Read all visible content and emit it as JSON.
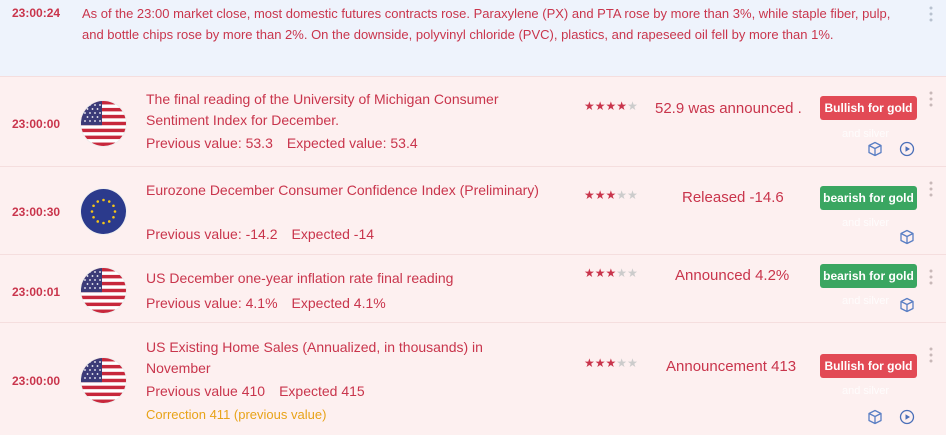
{
  "news": {
    "time": "23:00:24",
    "text": "As of the 23:00 market close, most domestic futures contracts rose. Paraxylene (PX) and PTA rose by more than 3%, while staple fiber, pulp, and bottle chips rose by more than 2%. On the downside, polyvinyl chloride (PVC), plastics, and rapeseed oil fell by more than 1%."
  },
  "events": [
    {
      "time": "23:00:00",
      "flag": "us-flag-icon",
      "title": "The final reading of the University of Michigan Consumer Sentiment Index for December.",
      "previous": "Previous value: 53.3",
      "expected": "Expected value: 53.4",
      "stars": 4,
      "actual": "52.9 was announced .",
      "badge": "Bullish for gold",
      "badge_type": "bull",
      "badge_sub": "and silver"
    },
    {
      "time": "23:00:30",
      "flag": "eu-flag-icon",
      "title": "Eurozone December Consumer Confidence Index (Preliminary)",
      "previous": "Previous value: -14.2",
      "expected": "Expected -14",
      "stars": 3,
      "actual": "Released -14.6",
      "badge": "bearish for gold",
      "badge_type": "bear",
      "badge_sub": "and silver"
    },
    {
      "time": "23:00:01",
      "flag": "us-flag-icon",
      "title": "US December one-year inflation rate final reading",
      "previous": "Previous value: 4.1%",
      "expected": "Expected 4.1%",
      "stars": 3,
      "actual": "Announced 4.2%",
      "badge": "bearish for gold",
      "badge_type": "bear",
      "badge_sub": "and silver"
    },
    {
      "time": "23:00:00",
      "flag": "us-flag-icon",
      "title": "US Existing Home Sales (Annualized, in thousands) in November",
      "previous": "Previous value 410",
      "expected": "Expected 415",
      "correction": "Correction 411 (previous value)",
      "stars": 3,
      "actual": "Announcement 413",
      "badge": "Bullish for gold",
      "badge_type": "bull",
      "badge_sub": "and silver"
    }
  ],
  "colors": {
    "accent_red": "#c9354c",
    "bull_badge": "#e24a55",
    "bear_badge": "#3aa661",
    "correction": "#e8a318",
    "row_bg": "#fdf0f0",
    "news_bg": "#eef3fc"
  },
  "icons": [
    "more-vertical-icon",
    "cube-icon",
    "play-circle-icon",
    "star-icon"
  ]
}
